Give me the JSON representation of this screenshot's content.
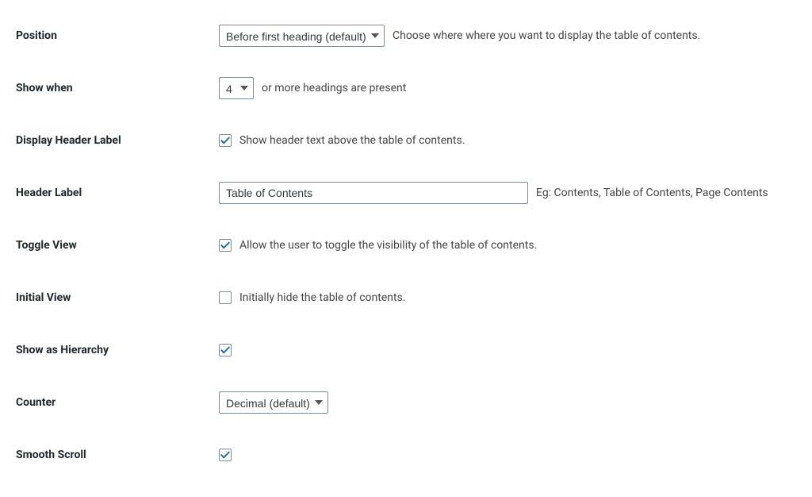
{
  "rows": {
    "position": {
      "label": "Position",
      "selected": "Before first heading (default)",
      "help": "Choose where where you want to display the table of contents."
    },
    "showWhen": {
      "label": "Show when",
      "selected": "4",
      "help": "or more headings are present"
    },
    "displayHeader": {
      "label": "Display Header Label",
      "checked": true,
      "desc": "Show header text above the table of contents."
    },
    "headerLabel": {
      "label": "Header Label",
      "value": "Table of Contents",
      "help": "Eg: Contents, Table of Contents, Page Contents"
    },
    "toggleView": {
      "label": "Toggle View",
      "checked": true,
      "desc": "Allow the user to toggle the visibility of the table of contents."
    },
    "initialView": {
      "label": "Initial View",
      "checked": false,
      "desc": "Initially hide the table of contents."
    },
    "hierarchy": {
      "label": "Show as Hierarchy",
      "checked": true
    },
    "counter": {
      "label": "Counter",
      "selected": "Decimal (default)"
    },
    "smoothScroll": {
      "label": "Smooth Scroll",
      "checked": true
    }
  }
}
